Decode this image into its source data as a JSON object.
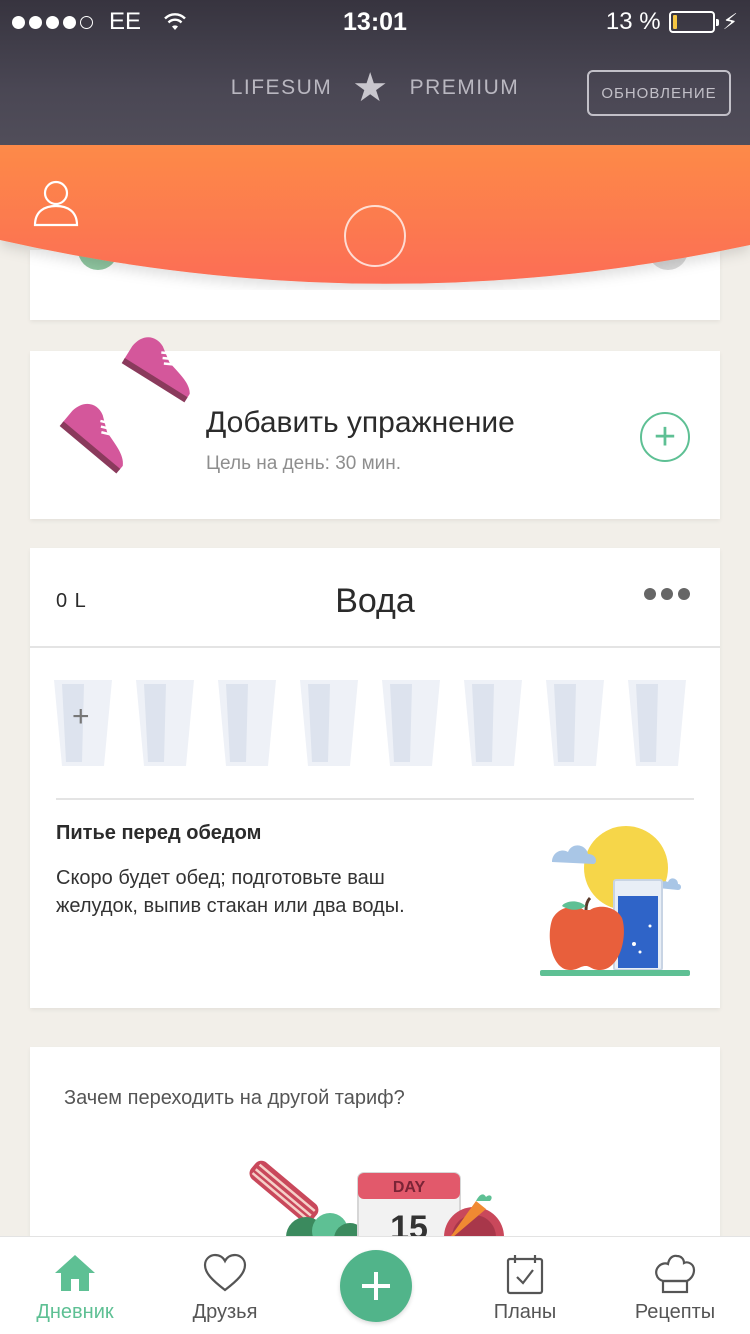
{
  "status_bar": {
    "carrier": "EE",
    "time": "13:01",
    "battery": "13 %",
    "battery_level": 0.13
  },
  "header": {
    "brand_left": "LIFESUM",
    "brand_right": "PREMIUM",
    "upgrade_button": "ОБНОВЛЕНИЕ",
    "colors": {
      "orange_start": "#fd8d4a",
      "orange_end": "#fc6f57"
    }
  },
  "exercise": {
    "title": "Добавить упражнение",
    "subtitle": "Цель на день: 30 мин."
  },
  "water": {
    "amount": "0 L",
    "title": "Вода",
    "glass_count": 8,
    "tip_title": "Питье перед обедом",
    "tip_text": "Скоро будет обед; подготовьте ваш желудок, выпив стакан или два воды."
  },
  "upgrade_card": {
    "question": "Зачем переходить на другой тариф?",
    "calendar_label": "DAY",
    "calendar_number": "15"
  },
  "tabbar": {
    "items": [
      {
        "label": "Дневник",
        "icon": "home-icon",
        "active": true
      },
      {
        "label": "Друзья",
        "icon": "heart-icon",
        "active": false
      },
      {
        "label": "Планы",
        "icon": "calendar-check-icon",
        "active": false
      },
      {
        "label": "Рецепты",
        "icon": "chef-hat-icon",
        "active": false
      }
    ],
    "accent": "#5ec094"
  }
}
